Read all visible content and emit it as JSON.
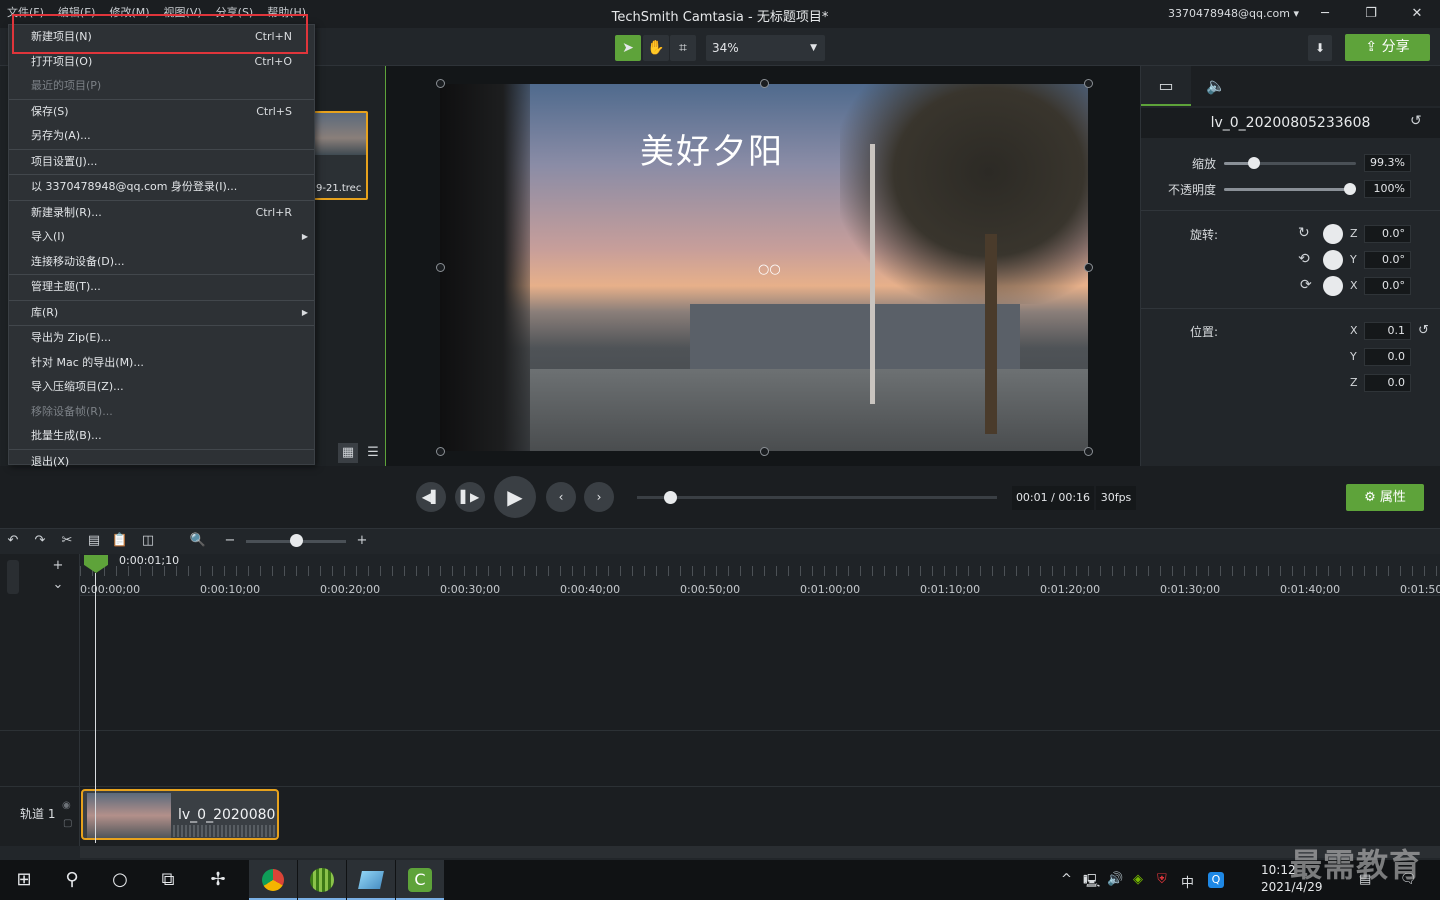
{
  "window": {
    "title": "TechSmith Camtasia - 无标题项目*",
    "account": "3370478948@qq.com",
    "minimize": "─",
    "maximize": "❐",
    "close": "✕"
  },
  "menubar": [
    "文件(F)",
    "编辑(E)",
    "修改(M)",
    "视图(V)",
    "分享(S)",
    "帮助(H)"
  ],
  "file_menu": [
    {
      "label": "新建项目(N)",
      "shortcut": "Ctrl+N",
      "disabled": false,
      "submenu": false
    },
    {
      "label": "打开项目(O)",
      "shortcut": "Ctrl+O",
      "disabled": false,
      "submenu": false
    },
    {
      "label": "最近的项目(P)",
      "shortcut": "",
      "disabled": true,
      "submenu": false,
      "sep_after": true
    },
    {
      "label": "保存(S)",
      "shortcut": "Ctrl+S",
      "disabled": false,
      "submenu": false
    },
    {
      "label": "另存为(A)...",
      "shortcut": "",
      "disabled": false,
      "submenu": false,
      "sep_after": true
    },
    {
      "label": "项目设置(J)...",
      "shortcut": "",
      "disabled": false,
      "submenu": false,
      "sep_after": true
    },
    {
      "label": "以 3370478948@qq.com 身份登录(I)...",
      "shortcut": "",
      "disabled": false,
      "submenu": false,
      "sep_after": true
    },
    {
      "label": "新建录制(R)...",
      "shortcut": "Ctrl+R",
      "disabled": false,
      "submenu": false
    },
    {
      "label": "导入(I)",
      "shortcut": "",
      "disabled": false,
      "submenu": true
    },
    {
      "label": "连接移动设备(D)...",
      "shortcut": "",
      "disabled": false,
      "submenu": false,
      "sep_after": true
    },
    {
      "label": "管理主题(T)...",
      "shortcut": "",
      "disabled": false,
      "submenu": false,
      "sep_after": true
    },
    {
      "label": "库(R)",
      "shortcut": "",
      "disabled": false,
      "submenu": true,
      "sep_after": true
    },
    {
      "label": "导出为 Zip(E)...",
      "shortcut": "",
      "disabled": false,
      "submenu": false
    },
    {
      "label": "针对 Mac 的导出(M)...",
      "shortcut": "",
      "disabled": false,
      "submenu": false
    },
    {
      "label": "导入压缩项目(Z)...",
      "shortcut": "",
      "disabled": false,
      "submenu": false
    },
    {
      "label": "移除设备帧(R)...",
      "shortcut": "",
      "disabled": true,
      "submenu": false
    },
    {
      "label": "批量生成(B)...",
      "shortcut": "",
      "disabled": false,
      "submenu": false,
      "sep_after": true
    },
    {
      "label": "退出(X)",
      "shortcut": "",
      "disabled": false,
      "submenu": false
    }
  ],
  "toolbar": {
    "zoom": "34%",
    "share_label": "分享"
  },
  "media": {
    "thumb_label": "9-21.trec"
  },
  "canvas": {
    "caption": "美好夕阳"
  },
  "properties": {
    "clip_name": "lv_0_20200805233608",
    "scale_label": "缩放",
    "scale_value": "99.3%",
    "scale_fraction": 0.993,
    "opacity_label": "不透明度",
    "opacity_value": "100%",
    "opacity_fraction": 1.0,
    "rotation_label": "旋转:",
    "rotation": [
      {
        "axis": "Z",
        "value": "0.0°"
      },
      {
        "axis": "Y",
        "value": "0.0°"
      },
      {
        "axis": "X",
        "value": "0.0°"
      }
    ],
    "position_label": "位置:",
    "position": [
      {
        "axis": "X",
        "value": "0.1"
      },
      {
        "axis": "Y",
        "value": "0.0"
      },
      {
        "axis": "Z",
        "value": "0.0"
      }
    ]
  },
  "playback": {
    "time": "00:01 / 00:16",
    "fps": "30fps",
    "props_label": "属性"
  },
  "timeline": {
    "playhead_time": "0:00:01;10",
    "ruler_labels": [
      "0:00:00;00",
      "0:00:10;00",
      "0:00:20;00",
      "0:00:30;00",
      "0:00:40;00",
      "0:00:50;00",
      "0:01:00;00",
      "0:01:10;00",
      "0:01:20;00",
      "0:01:30;00",
      "0:01:40;00",
      "0:01:50;"
    ],
    "track_label": "轨道 1",
    "clip_name": "lv_0_2020080"
  },
  "taskbar": {
    "time": "10:12",
    "date": "2021/4/29",
    "ime": "中",
    "watermark": "最需教育"
  },
  "colors": {
    "accent": "#5ea33a",
    "highlight": "#e0353b",
    "selection": "#e7a21d"
  }
}
